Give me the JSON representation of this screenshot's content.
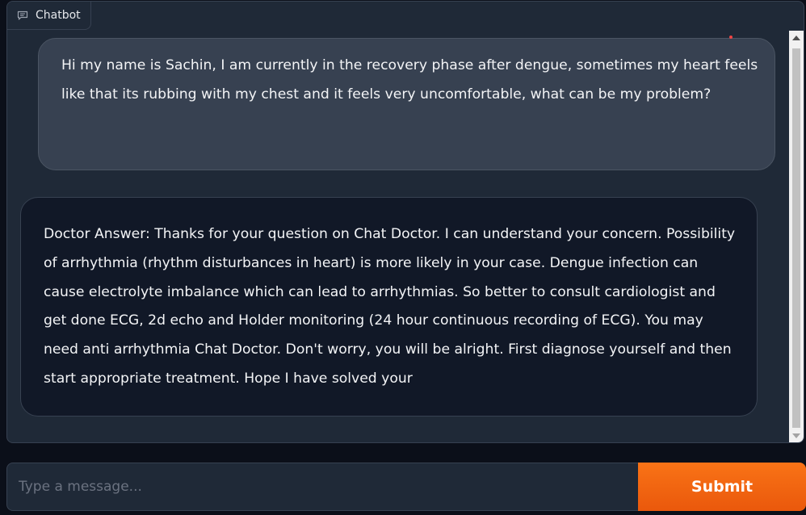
{
  "chatbot": {
    "label": "Chatbot",
    "label_icon": "chat-bubble-icon"
  },
  "messages": [
    {
      "role": "user",
      "text": "Hi my name is Sachin, I am currently in the recovery phase after dengue, sometimes my heart feels like that its rubbing with my chest and it feels very uncomfortable, what can be my problem?"
    },
    {
      "role": "bot",
      "text": "Doctor Answer: Thanks for your question on Chat Doctor. I can understand your concern. Possibility of arrhythmia (rhythm disturbances in heart) is more likely in your case. Dengue infection can cause electrolyte imbalance which can lead to arrhythmias. So better to consult cardiologist and get done ECG, 2d echo and Holder monitoring (24 hour continuous recording of ECG). You may need anti arrhythmia Chat Doctor. Don't worry, you will be alright. First diagnose yourself and then start appropriate treatment. Hope I have solved your"
    }
  ],
  "input": {
    "placeholder": "Type a message...",
    "value": ""
  },
  "submit": {
    "label": "Submit"
  },
  "colors": {
    "background": "#0b0f19",
    "panel": "#1f2937",
    "user_bubble": "#374151",
    "bot_bubble": "#111827",
    "accent": "#f97316"
  }
}
